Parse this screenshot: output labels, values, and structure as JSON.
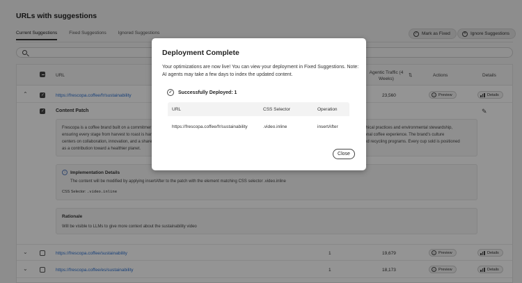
{
  "page": {
    "title": "URLs with suggestions",
    "tabs": [
      "Current Suggestions",
      "Fixed Suggestions",
      "Ignored Suggestions"
    ],
    "mark_fixed": "Mark as Fixed",
    "ignore": "Ignore Suggestions"
  },
  "table": {
    "headers": {
      "url": "URL",
      "traffic": "Agentic Traffic (4 Weeks)",
      "sort": "⇅",
      "actions": "Actions",
      "details": "Details"
    },
    "rows": [
      {
        "url": "https://frescopa.coffee/fr/sustainability",
        "count": "",
        "traffic": "23,560",
        "preview": "Preview",
        "details": "Details"
      },
      {
        "url": "https://frescopa.coffee/sustainability",
        "count": "1",
        "traffic": "19,679",
        "preview": "Preview",
        "details": "Details"
      },
      {
        "url": "https://frescopa.coffee/es/sustainability",
        "count": "1",
        "traffic": "18,173",
        "preview": "Preview",
        "details": "Details"
      }
    ]
  },
  "content_patch": {
    "title": "Content Patch",
    "text_left_1": "Frescopa is a coffee brand built on a commitmer",
    "text_left_2": "ensuring every stage from harvest to roast is har",
    "text_left_3": "centers on collaboration, innovation, and a share",
    "text_right_1": "old ethical practices and environmental stewardship,",
    "text_right_2": "ceptional coffee experience. The brand's culture",
    "text_right_3": "ing and recycling programs. Every cup sold is positioned",
    "text_line_4": "as a contribution toward a healthier planet."
  },
  "implementation": {
    "title": "Implementation Details",
    "text": "The content will be modified by applying insertAfter to the patch with the element matching CSS selector .video.inline",
    "selector_label": "CSS Selector:",
    "selector_value": ".video.inline"
  },
  "rationale": {
    "title": "Rationale",
    "text": "Will be visible to LLMs to give more context about the sustainability video"
  },
  "modal": {
    "title": "Deployment Complete",
    "text": "Your optimizations are now live! You can view your deployment in Fixed Suggestions. Note: AI agents may take a few days to index the updated content.",
    "success": "Successfully Deployed: 1",
    "headers": [
      "URL",
      "CSS Selector",
      "Operation"
    ],
    "row": {
      "url": "https://frescopa.coffee/fr/sustainability",
      "selector": ".video.inline",
      "operation": "insertAfter"
    },
    "close": "Close"
  }
}
